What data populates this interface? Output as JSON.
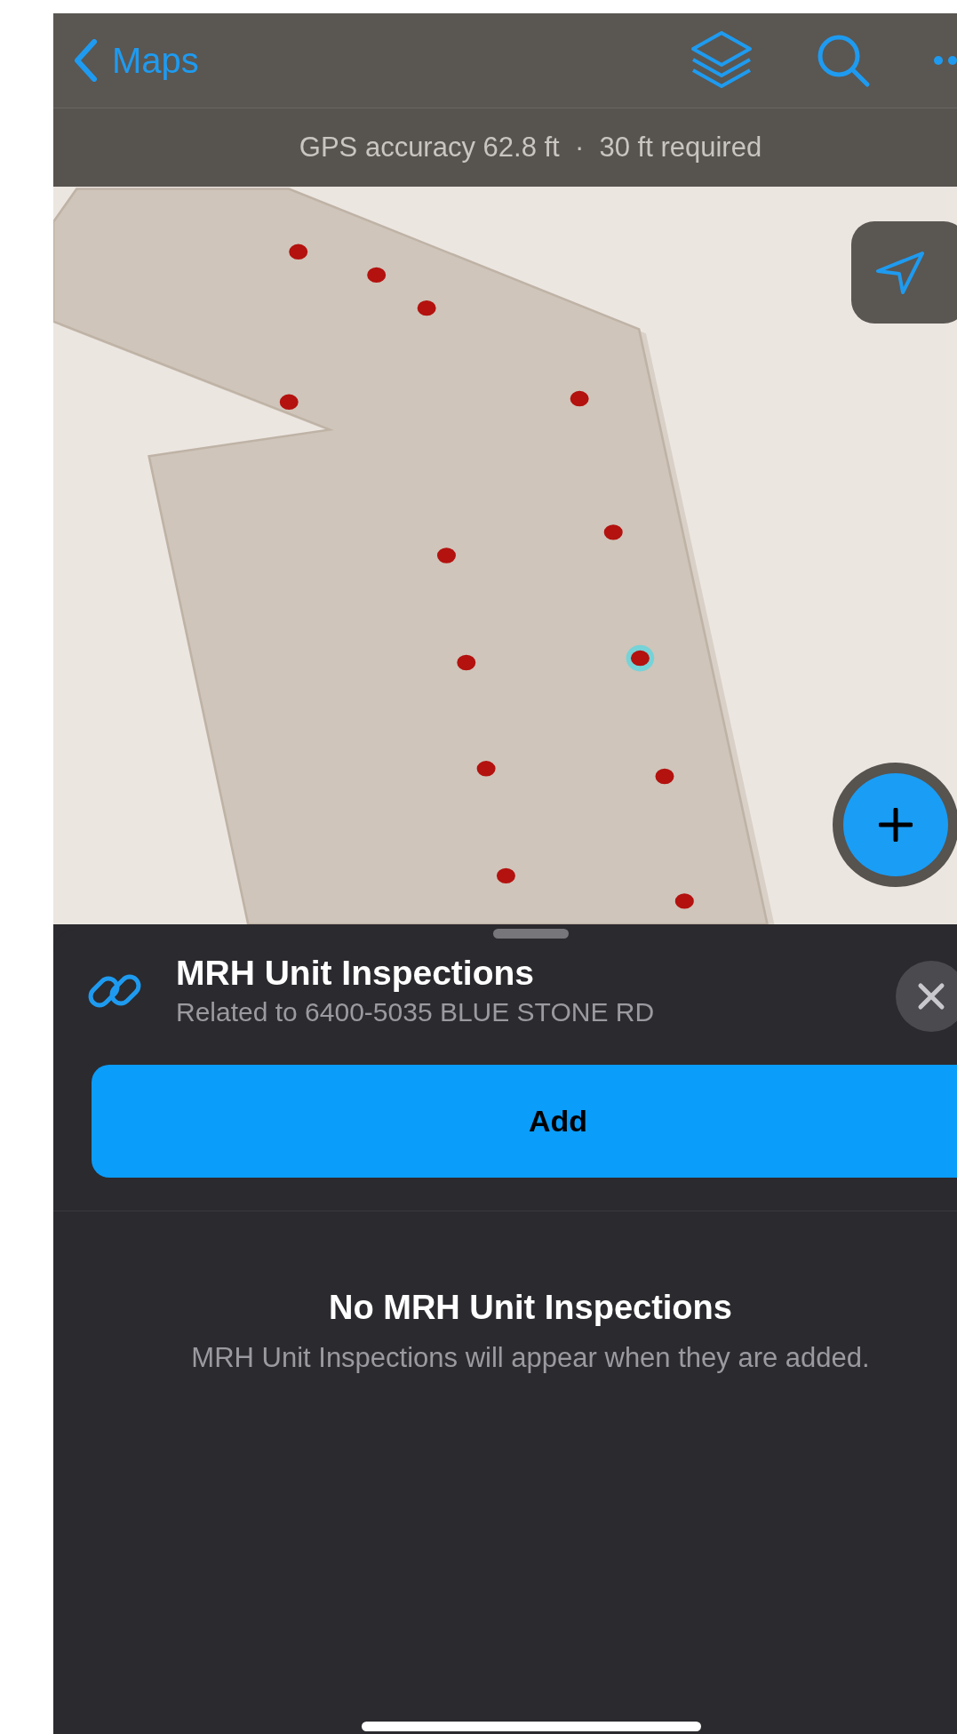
{
  "nav": {
    "back_label": "Maps"
  },
  "gps_status": {
    "text": "GPS accuracy 62.8 ft  ·  30 ft required"
  },
  "sheet": {
    "title": "MRH Unit Inspections",
    "subtitle": "Related to 6400-5035 BLUE STONE RD",
    "add_button": "Add",
    "empty_title": "No MRH Unit Inspections",
    "empty_message": "MRH Unit Inspections will appear when they are added."
  }
}
